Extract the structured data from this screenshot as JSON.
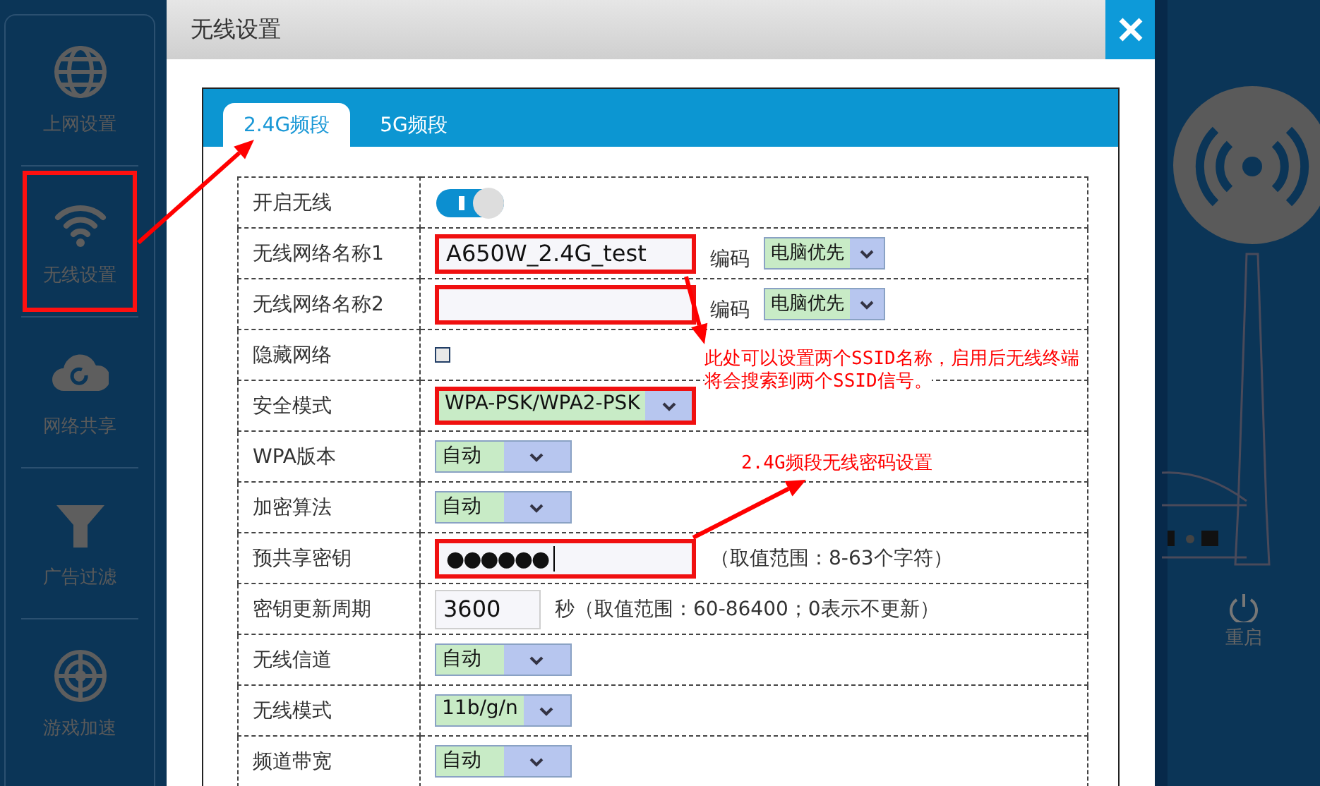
{
  "sidebar": {
    "items": [
      {
        "label": "上网设置",
        "highlighted": false
      },
      {
        "label": "无线设置",
        "highlighted": true
      },
      {
        "label": "网络共享",
        "highlighted": false
      },
      {
        "label": "广告过滤",
        "highlighted": false
      },
      {
        "label": "游戏加速",
        "highlighted": false
      }
    ]
  },
  "dialog": {
    "title": "无线设置",
    "tabs": [
      {
        "label": "2.4G频段",
        "selected": true
      },
      {
        "label": "5G频段",
        "selected": false
      }
    ],
    "rows": [
      {
        "kind": "toggle",
        "label": "开启无线",
        "on": true
      },
      {
        "kind": "text",
        "label": "无线网络名称1",
        "value": "A650W_2.4G_test",
        "highlighted": true,
        "extra_label": "编码",
        "extra_value": "电脑优先"
      },
      {
        "kind": "text",
        "label": "无线网络名称2",
        "highlighted": true,
        "extra_label": "编码",
        "extra_value": "电脑优先"
      },
      {
        "kind": "checkbox",
        "label": "隐藏网络",
        "checked": false
      },
      {
        "kind": "select",
        "label": "安全模式",
        "value": "WPA-PSK/WPA2-PSK",
        "highlighted": true
      },
      {
        "kind": "select",
        "label": "WPA版本",
        "value": "自动",
        "highlighted": false
      },
      {
        "kind": "select",
        "label": "加密算法",
        "value": "自动",
        "highlighted": false
      },
      {
        "kind": "password",
        "label": "预共享密钥",
        "value": "●●●●●●",
        "highlighted": true,
        "hint": "（取值范围：8-63个字符）"
      },
      {
        "kind": "text",
        "label": "密钥更新周期",
        "value": "3600",
        "highlighted": false,
        "hint": "秒（取值范围：60-86400；0表示不更新）"
      },
      {
        "kind": "select",
        "label": "无线信道",
        "value": "自动",
        "highlighted": false
      },
      {
        "kind": "select",
        "label": "无线模式",
        "value": "11b/g/n",
        "highlighted": false
      },
      {
        "kind": "select",
        "label": "频道带宽",
        "value": "自动",
        "highlighted": false
      }
    ]
  },
  "device": {
    "restart_label": "重启"
  },
  "annotations": [
    {
      "lines": [
        "此处可以设置两个SSID名称，启用后无线终端",
        "将会搜索到两个SSID信号。"
      ]
    },
    {
      "lines": [
        "2.4G频段无线密码设置"
      ]
    }
  ]
}
